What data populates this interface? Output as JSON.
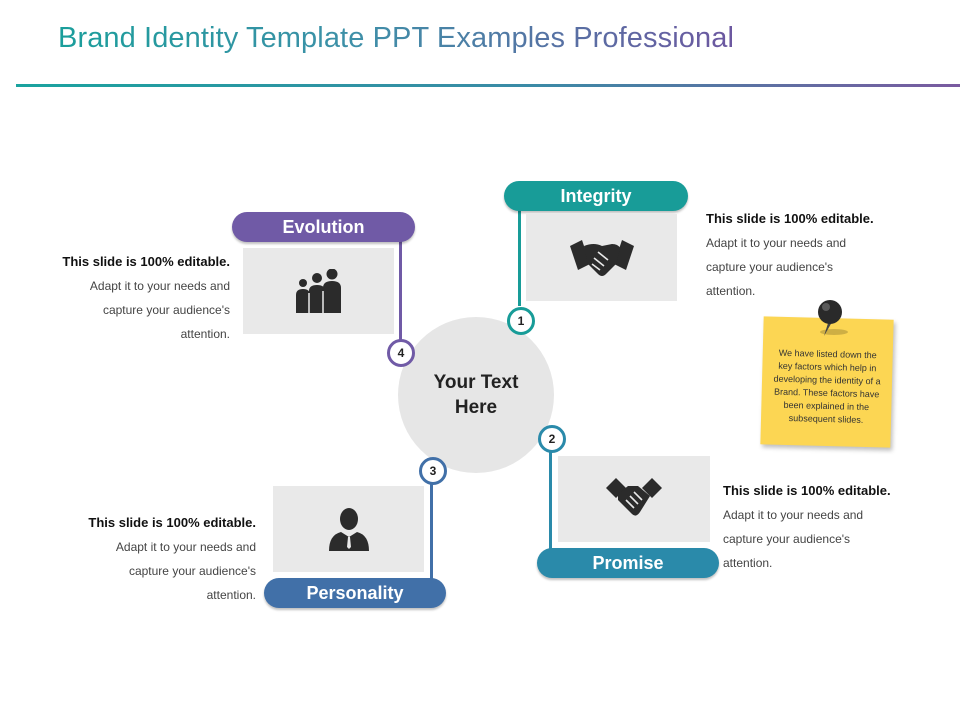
{
  "slide": {
    "title": "Brand Identity Template PPT Examples Professional",
    "center_text": "Your Text Here",
    "note_text": "We have listed down the key factors which help in developing the identity of a Brand. These factors have been explained in the subsequent slides."
  },
  "colors": {
    "integrity": "#189c98",
    "promise": "#2a8aaa",
    "personality": "#4170a8",
    "evolution": "#705aa6"
  },
  "steps": [
    {
      "number": "1",
      "label": "Integrity",
      "icon": "handshake-icon",
      "heading": "This slide is 100% editable.",
      "lines": [
        "Adapt it to your needs and",
        "capture your audience's",
        "attention."
      ]
    },
    {
      "number": "2",
      "label": "Promise",
      "icon": "handshake-deal-icon",
      "heading": "This slide is 100% editable.",
      "lines": [
        "Adapt it to your needs and",
        "capture your audience's",
        "attention."
      ]
    },
    {
      "number": "3",
      "label": "Personality",
      "icon": "businessman-icon",
      "heading": "This slide is 100% editable.",
      "lines": [
        "Adapt it to your needs and",
        "capture your audience's",
        "attention."
      ]
    },
    {
      "number": "4",
      "label": "Evolution",
      "icon": "people-group-icon",
      "heading": "This slide is 100% editable.",
      "lines": [
        "Adapt it to your needs and",
        "capture your audience's",
        "attention."
      ]
    }
  ]
}
